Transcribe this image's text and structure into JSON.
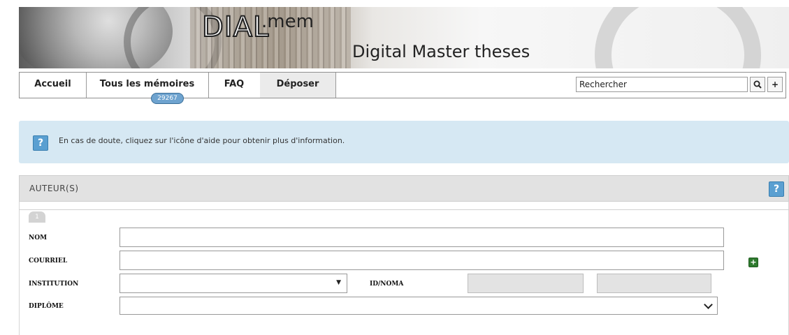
{
  "banner": {
    "logo_dial": "DIAL",
    "logo_mem": ".mem",
    "tagline": "Digital Master theses"
  },
  "nav": {
    "items": [
      {
        "label": "Accueil"
      },
      {
        "label": "Tous les mémoires"
      },
      {
        "label": "FAQ"
      },
      {
        "label": "Déposer"
      }
    ],
    "memoires_count": "29267",
    "search_placeholder": "Rechercher",
    "search_button": "search-icon",
    "add_button": "+"
  },
  "info": {
    "icon": "?",
    "message": "En cas de doute, cliquez sur l'icône d'aide pour obtenir plus d'information."
  },
  "authors": {
    "title": "AUTEUR(S)",
    "help_icon": "?",
    "tab_number": "1",
    "fields": {
      "nom_label": "NOM",
      "courriel_label": "COURRIEL",
      "institution_label": "INSTITUTION",
      "idnoma_label": "ID/NOMA",
      "diplome_label": "DIPLÔME"
    },
    "add_author_icon": "+"
  }
}
